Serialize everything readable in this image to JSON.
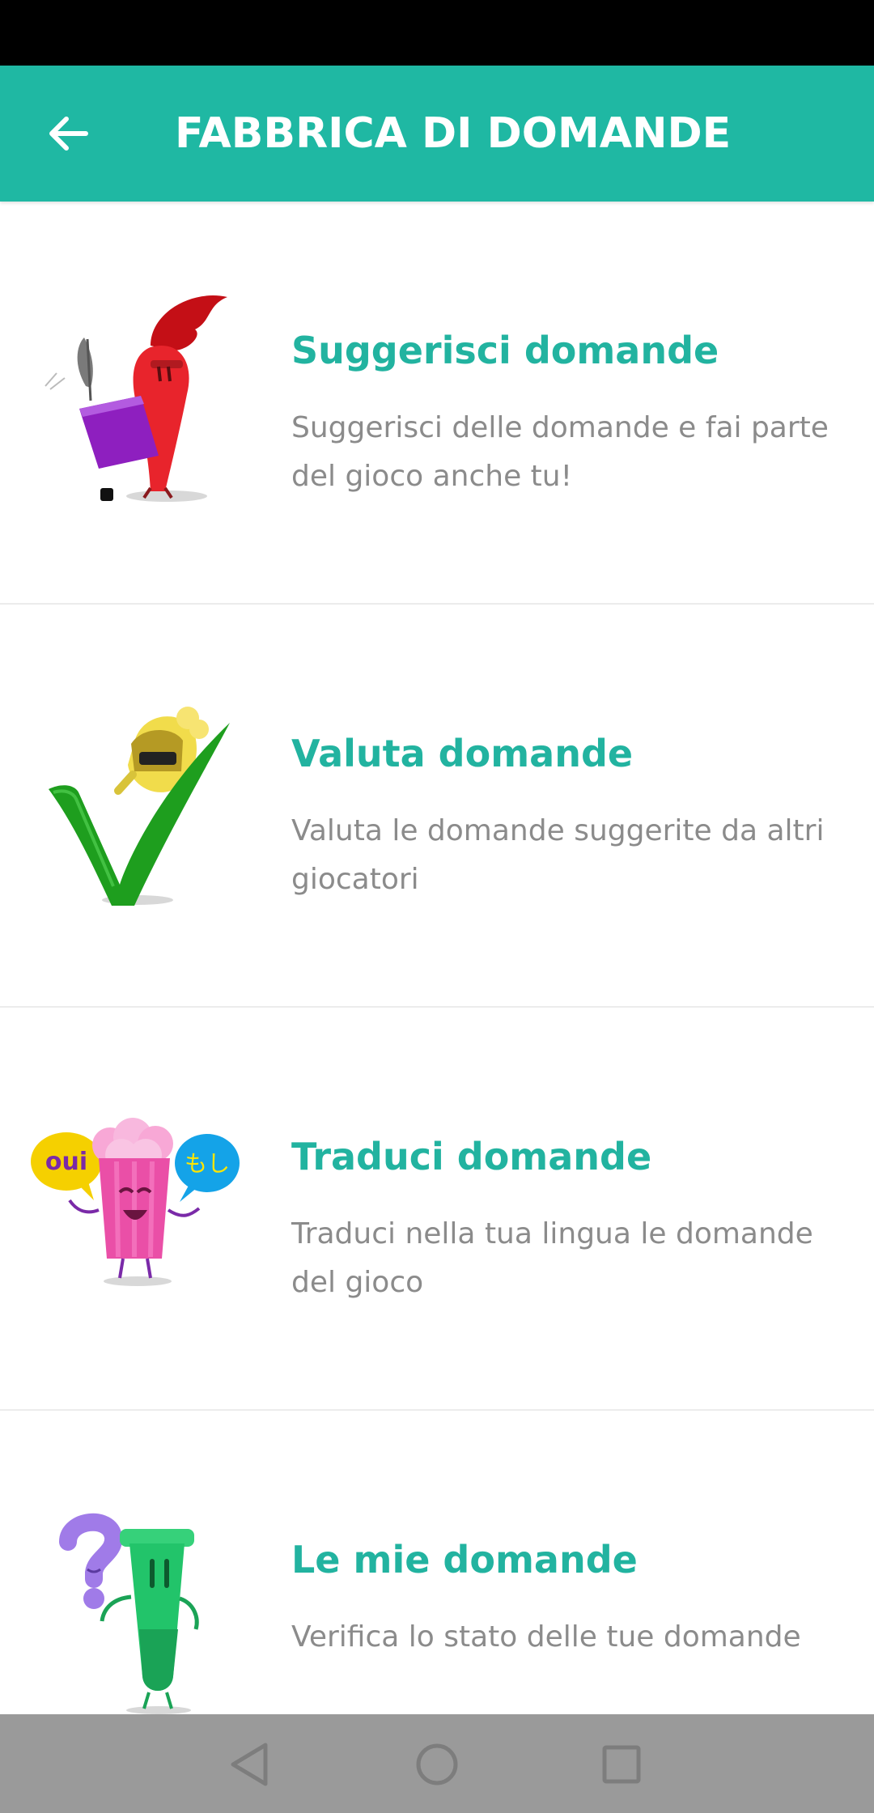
{
  "app_bar": {
    "title": "FABBRICA DI DOMANDE",
    "back_icon": "arrow-left-icon"
  },
  "colors": {
    "teal": "#1fb8a3",
    "title_teal": "#22b3a0",
    "description_gray": "#8b8b8b",
    "nav_gray": "#9a9a9a"
  },
  "items": [
    {
      "title": "Suggerisci domande",
      "description": "Suggerisci delle domande e fai parte del gioco anche tu!",
      "icon": "red-pencil-character-writing-icon"
    },
    {
      "title": "Valuta domande",
      "description": "Valuta le domande suggerite da altri giocatori",
      "icon": "knight-on-checkmark-icon"
    },
    {
      "title": "Traduci domande",
      "description": "Traduci nella tua lingua le domande del gioco",
      "icon": "popcorn-with-speech-bubbles-icon",
      "bubble_left": "oui",
      "bubble_right": "もし"
    },
    {
      "title": "Le mie domande",
      "description": "Verifica lo stato delle tue domande",
      "icon": "test-tube-with-question-mark-icon"
    }
  ],
  "nav_bar": {
    "back": "triangle-back-icon",
    "home": "circle-home-icon",
    "recents": "square-recents-icon"
  }
}
